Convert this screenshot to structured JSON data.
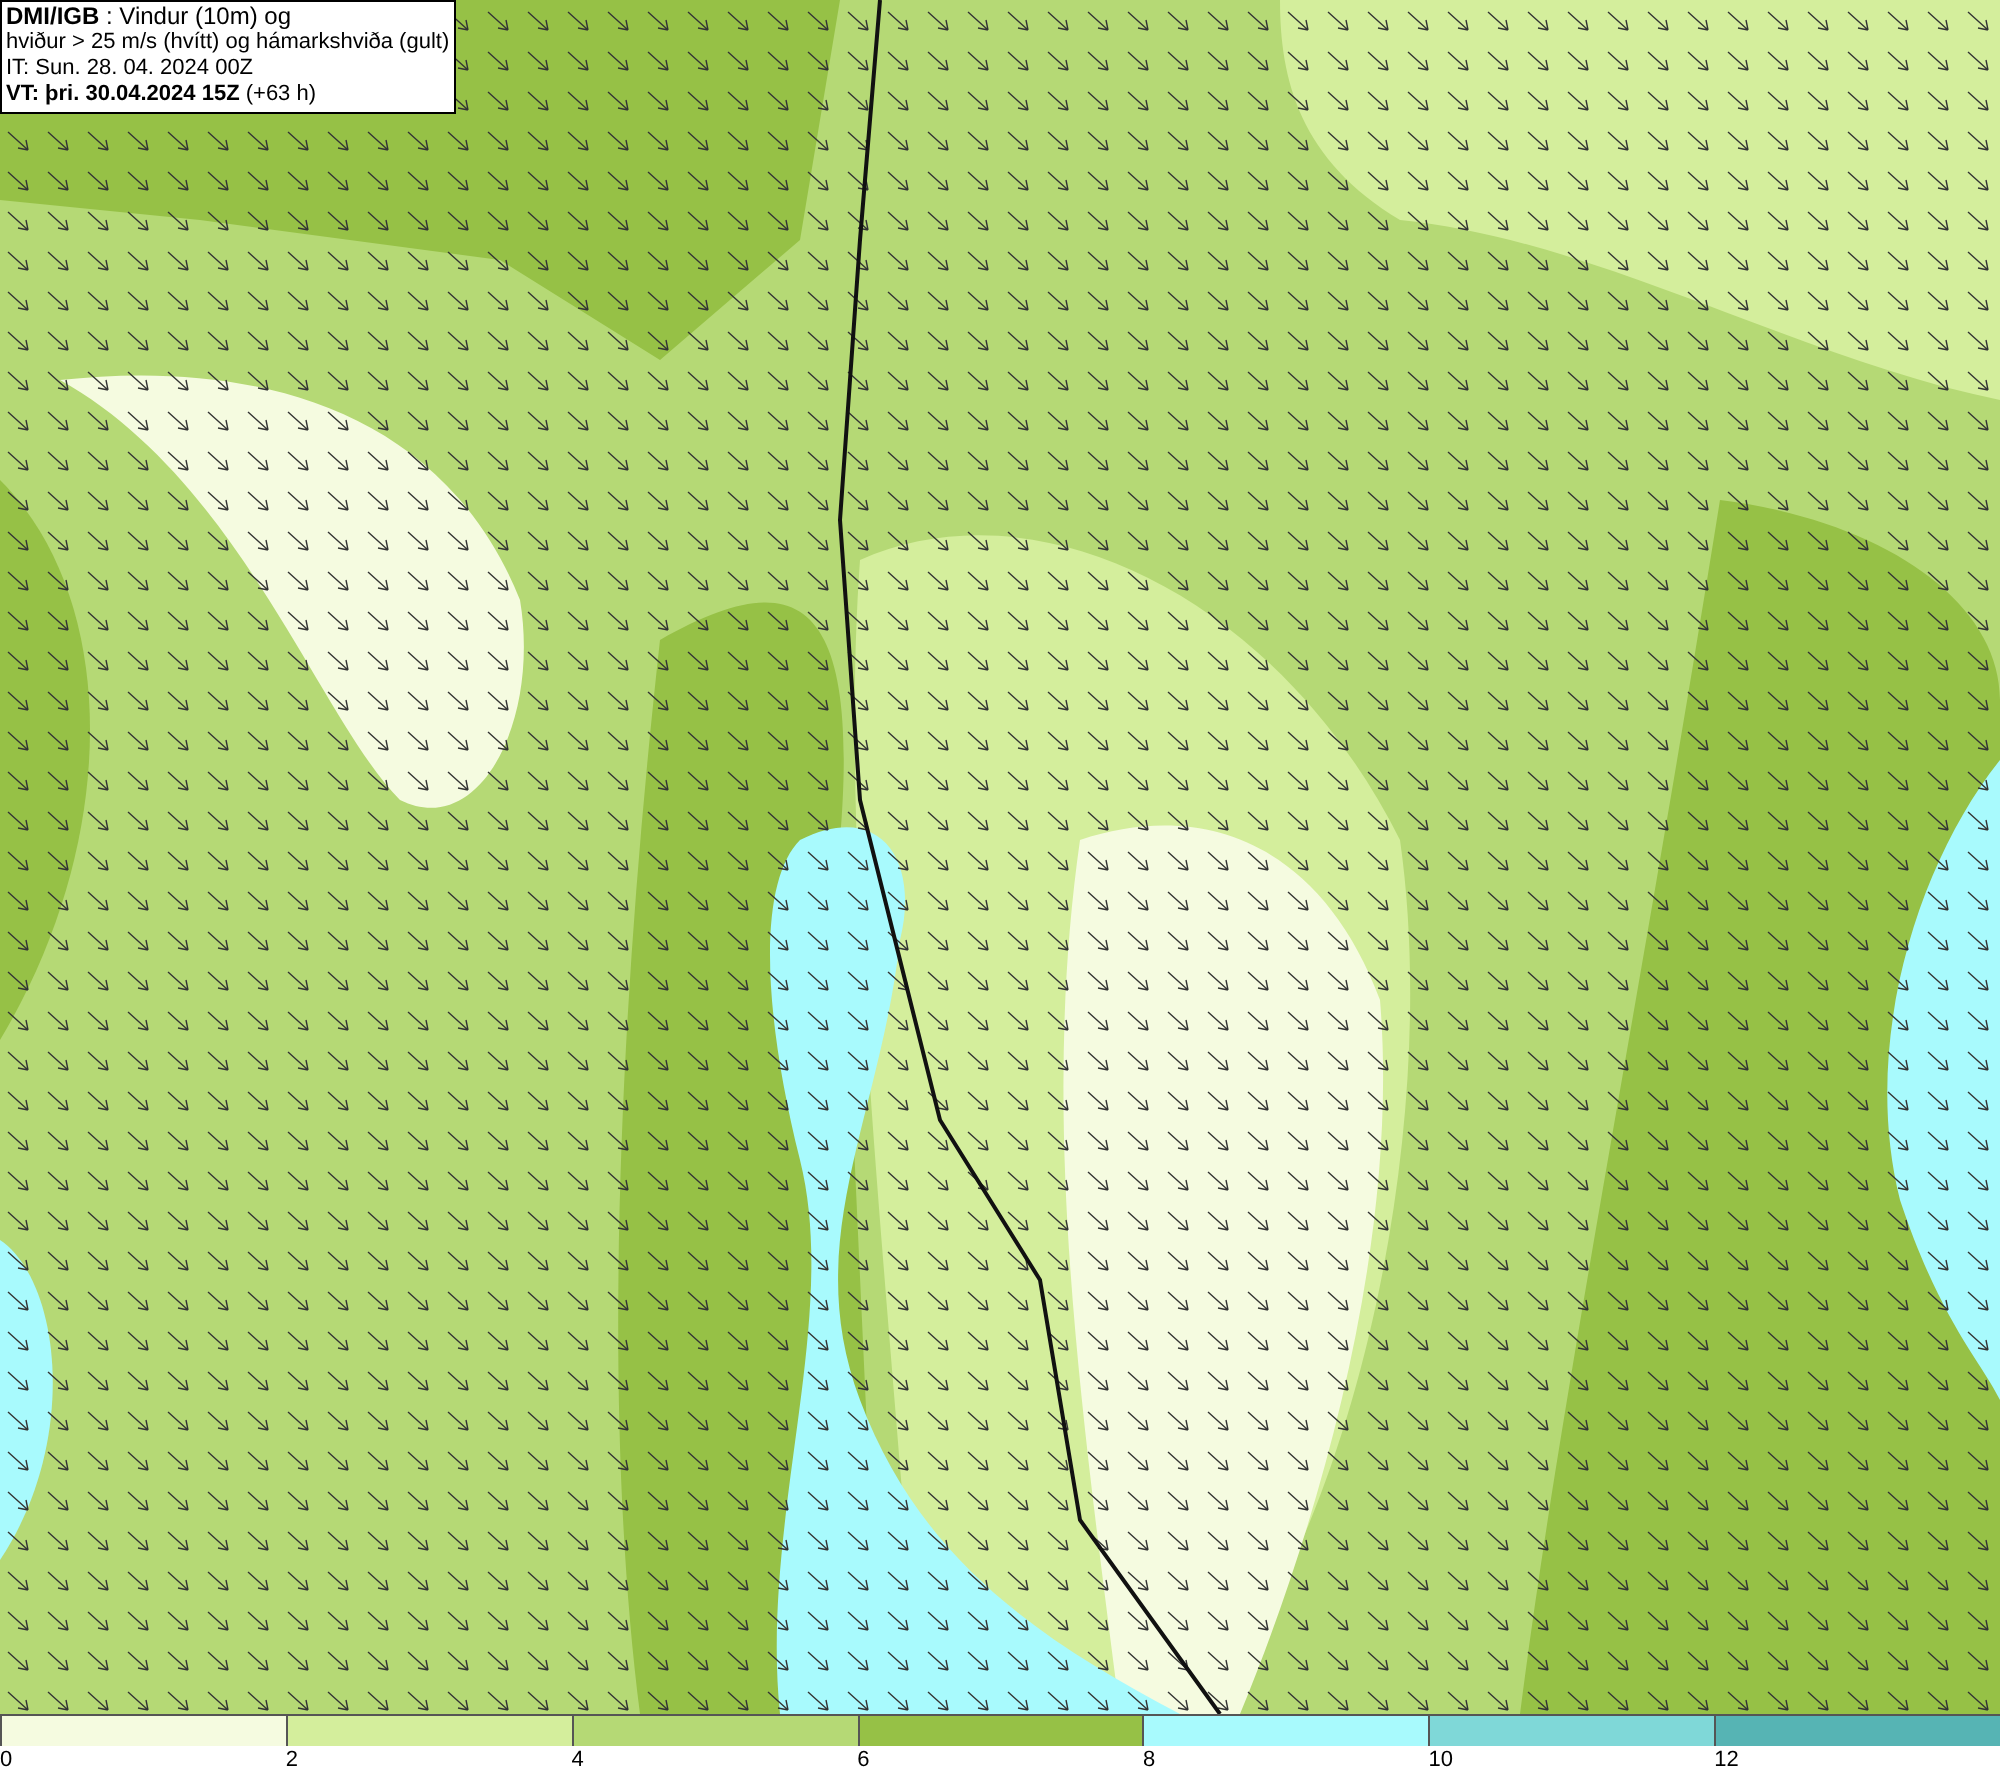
{
  "header": {
    "lines": [
      "**DMI/IGB** : Vindur (10m) og",
      "hviður > 25 m/s (hvítt) og hámarkshviða (gult)",
      "IT: Sun. 28. 04. 2024 00Z",
      "**VT: þri. 30.04.2024 15Z** (+63 h)"
    ]
  },
  "legend": {
    "bins": [
      {
        "label": "0",
        "color": "#f5fbe0"
      },
      {
        "label": "2",
        "color": "#d4ee9c"
      },
      {
        "label": "4",
        "color": "#b5d975"
      },
      {
        "label": "6",
        "color": "#96c146"
      },
      {
        "label": "8",
        "color": "#a8fafd"
      },
      {
        "label": "10",
        "color": "#7fd8d8"
      },
      {
        "label": "12",
        "color": "#56b4b4"
      }
    ]
  }
}
